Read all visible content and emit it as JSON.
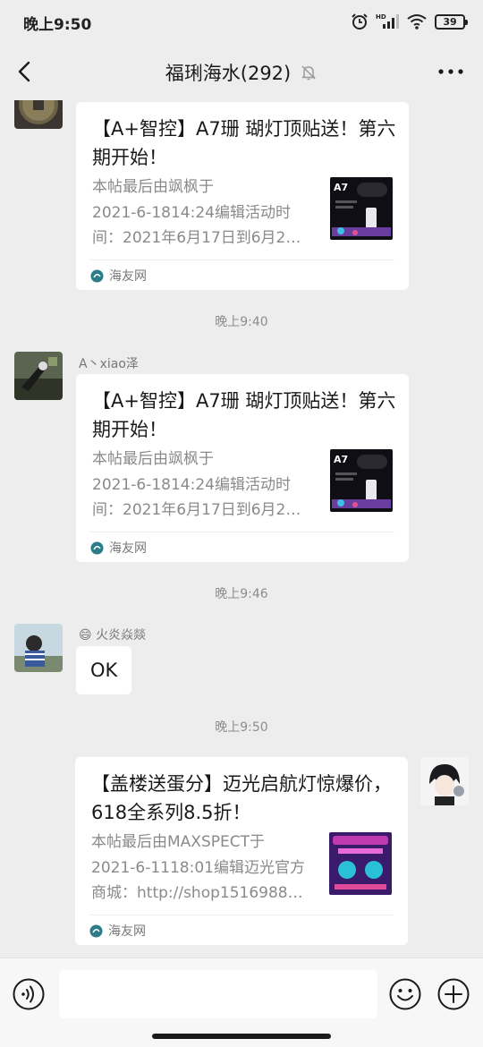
{
  "status_bar": {
    "time": "晚上9:50",
    "battery": "39",
    "icons": [
      "alarm-icon",
      "hd-signal-icon",
      "wifi-icon",
      "battery-icon"
    ]
  },
  "nav": {
    "title": "福琍海水(292)",
    "back_icon": "chevron-left-icon",
    "mute_icon": "bell-muted-icon",
    "more_icon": "more-dots-icon"
  },
  "messages": [
    {
      "card": {
        "title": "【A+智控】A7珊 瑚灯顶贴送！第六期开始！",
        "desc_lines": [
          "本帖最后由飒枫于",
          "2021-6-1814:24编辑活动时",
          "间：2021年6月17日到6月2…"
        ],
        "thumb_label": "A7",
        "source": "海友网"
      }
    },
    {
      "timestamp": "晚上9:40",
      "sender": "A丶xiao泽",
      "card": {
        "title": "【A+智控】A7珊 瑚灯顶贴送！第六期开始！",
        "desc_lines": [
          "本帖最后由飒枫于",
          "2021-6-1814:24编辑活动时",
          "间：2021年6月17日到6月2…"
        ],
        "thumb_label": "A7",
        "source": "海友网"
      }
    },
    {
      "timestamp": "晚上9:46",
      "sender_emoji": "😄",
      "sender": "火炎焱燚",
      "text": "OK"
    },
    {
      "timestamp": "晚上9:50",
      "card": {
        "title": "【盖楼送蛋分】迈光启航灯惊爆价，618全系列8.5折！",
        "desc_lines": [
          "本帖最后由MAXSPECT于",
          "2021-6-1118:01编辑迈光官方",
          "商城：http://shop1516988…"
        ],
        "source": "海友网"
      }
    }
  ],
  "input_bar": {
    "voice_icon": "voice-icon",
    "emoji_icon": "emoji-icon",
    "plus_icon": "plus-circle-icon",
    "value": ""
  },
  "colors": {
    "background": "#ededed",
    "card": "#ffffff",
    "timestamp": "#8d8d8d"
  }
}
